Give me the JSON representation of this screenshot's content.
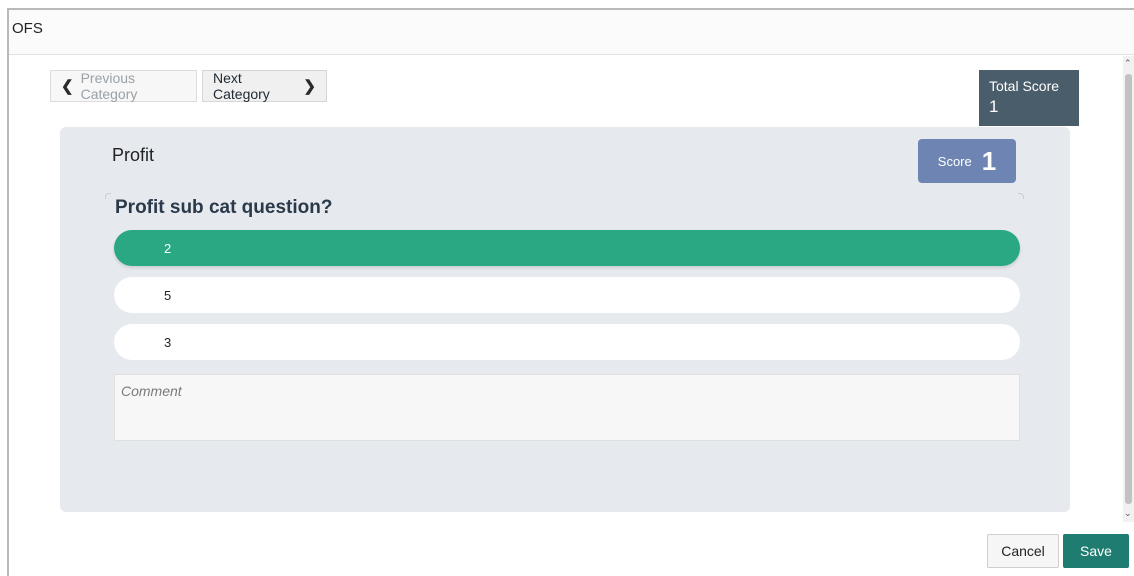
{
  "window": {
    "title": "OFS"
  },
  "nav": {
    "previous_label": "Previous Category",
    "next_label": "Next Category"
  },
  "total_score": {
    "label": "Total Score",
    "value": "1"
  },
  "category": {
    "title": "Profit",
    "score_label": "Score",
    "score_value": "1",
    "question": "Profit sub cat question?",
    "options": [
      {
        "label": "2",
        "selected": true
      },
      {
        "label": "5",
        "selected": false
      },
      {
        "label": "3",
        "selected": false
      }
    ],
    "comment_placeholder": "Comment",
    "comment_value": ""
  },
  "footer": {
    "cancel_label": "Cancel",
    "save_label": "Save"
  },
  "colors": {
    "selected_option": "#29a883",
    "score_badge": "#6e85b3",
    "total_score_bg": "#4a5d6a",
    "save_button": "#1f7c70",
    "card_bg": "#e6e9ee"
  }
}
